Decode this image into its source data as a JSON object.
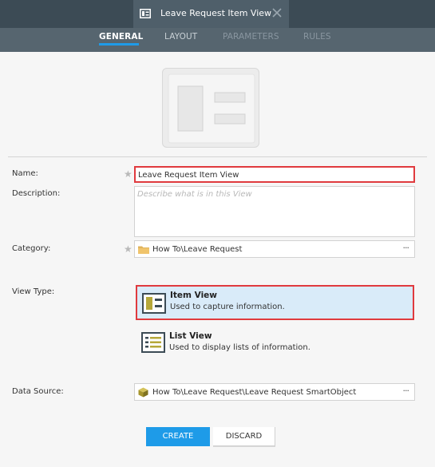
{
  "window": {
    "title": "Leave Request Item View",
    "close_icon": "close-icon"
  },
  "nav": {
    "tabs": [
      {
        "label": "GENERAL",
        "state": "active"
      },
      {
        "label": "LAYOUT",
        "state": "enabled"
      },
      {
        "label": "PARAMETERS",
        "state": "disabled"
      },
      {
        "label": "RULES",
        "state": "disabled"
      }
    ]
  },
  "form": {
    "name": {
      "label": "Name:",
      "required": "★",
      "value": "Leave Request Item View"
    },
    "description": {
      "label": "Description:",
      "placeholder": "Describe what is in this View"
    },
    "category": {
      "label": "Category:",
      "required": "★",
      "value": "How To\\Leave Request",
      "more": "···"
    },
    "view_type": {
      "label": "View Type:",
      "options": [
        {
          "title": "Item View",
          "desc": "Used to capture information.",
          "selected": true
        },
        {
          "title": "List View",
          "desc": "Used to display lists of information.",
          "selected": false
        }
      ]
    },
    "data_source": {
      "label": "Data Source:",
      "value": "How To\\Leave Request\\Leave Request SmartObject",
      "more": "···"
    }
  },
  "actions": {
    "create": "CREATE",
    "discard": "DISCARD"
  },
  "colors": {
    "accent": "#1e9be8",
    "highlight_border": "#e03a3e",
    "selected_bg": "#d9ebf9",
    "titlebar": "#3c4b55",
    "navbar": "#56656f"
  }
}
